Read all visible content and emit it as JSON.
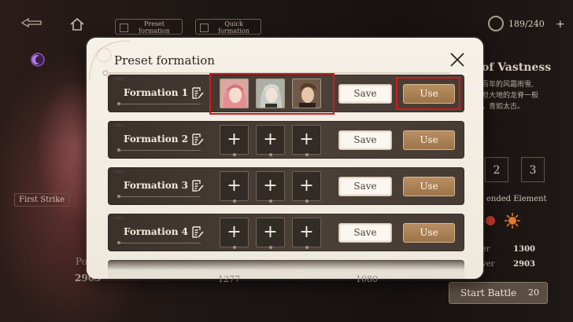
{
  "topbar": {
    "tabs": [
      {
        "label_line1": "Preset",
        "label_line2": "formation"
      },
      {
        "label_line1": "Quick",
        "label_line2": "formation"
      }
    ],
    "currency": {
      "value": "189/240",
      "plus": "+"
    }
  },
  "background": {
    "right_title": "of Vastness",
    "right_desc": "百年的风霜雨雪,\n担大地的龙脊一般\n，青如太古。",
    "numbers": [
      "2",
      "3"
    ],
    "recommended_label": "ended Element",
    "stats": [
      {
        "key": "er",
        "value": "1300"
      },
      {
        "key": "ver",
        "value": "2903"
      }
    ],
    "start_battle": {
      "label": "Start Battle",
      "cost": "20"
    },
    "left_badge": "First Strike",
    "left_stat_label": "Po",
    "left_stat_value": "2903",
    "below_nums": [
      "1277",
      "1080"
    ]
  },
  "modal": {
    "title": "Preset formation",
    "close_glyph": "✕",
    "row_deco": "ᚲᛟᚢᚾ",
    "slot_plus": "+",
    "save_label": "Save",
    "use_label": "Use",
    "formations": [
      {
        "name": "Formation 1",
        "filled": true
      },
      {
        "name": "Formation 2",
        "filled": false
      },
      {
        "name": "Formation 3",
        "filled": false
      },
      {
        "name": "Formation 4",
        "filled": false
      }
    ]
  },
  "colors": {
    "modal_bg": "#f6f1e8",
    "row_bg": "#3a312b",
    "use_button": "#b88e62",
    "highlight": "#d11a1a"
  }
}
